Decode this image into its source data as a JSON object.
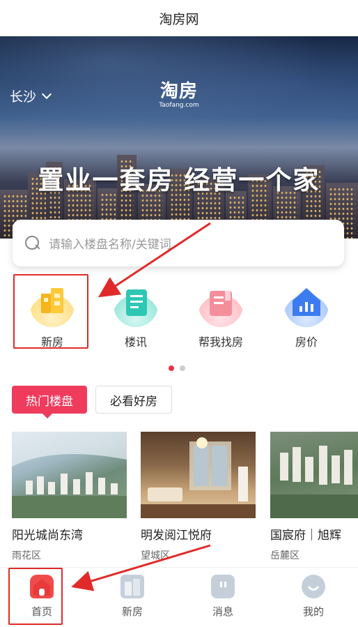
{
  "window": {
    "title": "淘房网"
  },
  "header": {
    "city": "长沙",
    "logo_cn": "淘房",
    "logo_en": "Taofang.com",
    "slogan": "置业一套房 经营一个家"
  },
  "search": {
    "placeholder": "请输入楼盘名称/关键词"
  },
  "menu": {
    "items": [
      {
        "label": "新房",
        "icon": "building-icon"
      },
      {
        "label": "楼讯",
        "icon": "news-icon"
      },
      {
        "label": "帮我找房",
        "icon": "book-icon"
      },
      {
        "label": "房价",
        "icon": "price-chart-icon"
      }
    ]
  },
  "tabs": [
    {
      "label": "热门楼盘"
    },
    {
      "label": "必看好房"
    }
  ],
  "listings": [
    {
      "name": "阳光城尚东湾",
      "district": "雨花区"
    },
    {
      "name": "明发阅江悦府",
      "district": "望城区"
    },
    {
      "name": "国宸府｜旭辉",
      "district": "岳麓区"
    }
  ],
  "tabbar": {
    "items": [
      {
        "label": "首页",
        "icon": "home-icon"
      },
      {
        "label": "新房",
        "icon": "building-icon"
      },
      {
        "label": "消息",
        "icon": "message-icon"
      },
      {
        "label": "我的",
        "icon": "user-icon"
      }
    ]
  },
  "colors": {
    "accent": "#ef3b5c",
    "highlight": "#e02a2a"
  }
}
